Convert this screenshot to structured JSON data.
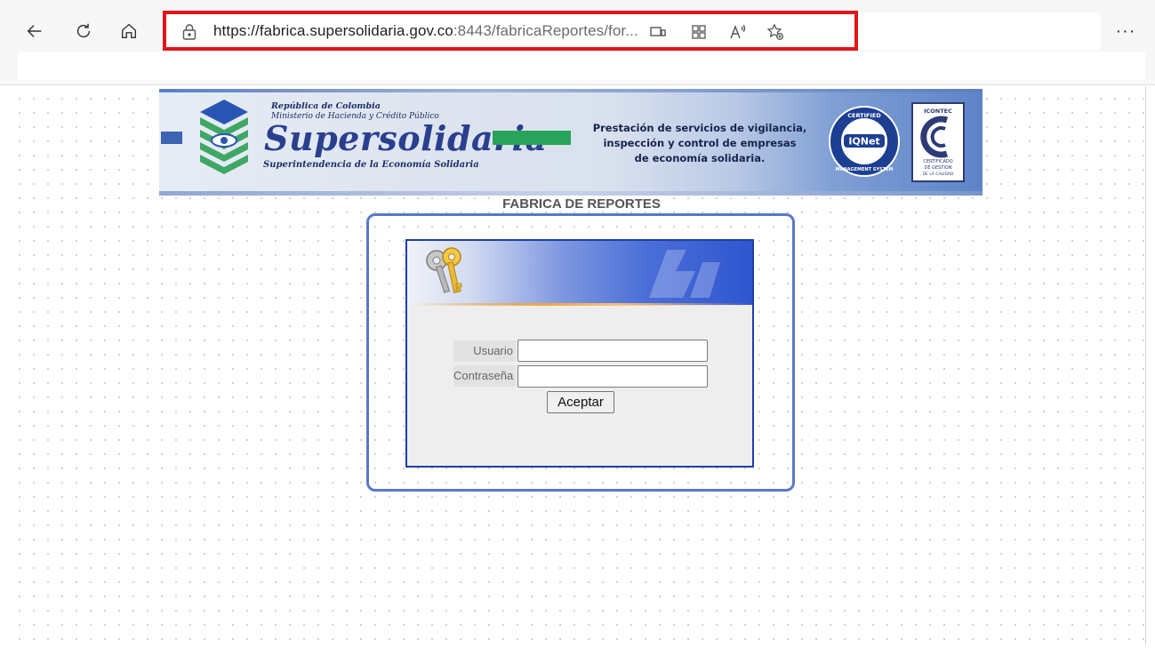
{
  "browser": {
    "address_bar": {
      "url_host": "https://fabrica.supersolidaria.gov.co",
      "url_rest": ":8443/fabricaReportes/for...",
      "icons": [
        "lock-icon",
        "immersive-reader-icon",
        "app-available-icon",
        "read-aloud-icon",
        "add-favorite-icon"
      ]
    },
    "more_label": "···",
    "highlight_color": "#e0161c"
  },
  "banner": {
    "republic": "República de Colombia",
    "ministry": "Ministerio de Hacienda y Crédito Público",
    "brand": "Supersolidaria",
    "subtitle": "Superintendencia de la Economía Solidaria",
    "tagline_1": "Prestación de servicios de vigilancia,",
    "tagline_2": "inspección y control de empresas",
    "tagline_3": "de economía solidaria.",
    "iqnet_top": "CERTIFIED",
    "iqnet_center": "IQNet",
    "iqnet_bottom": "MANAGEMENT SYSTEM",
    "icontec_top": "ICONTEC",
    "icontec_cert_1": "CERTIFICADO",
    "icontec_cert_2": "DE GESTION",
    "icontec_cert_3": "DE LA CALIDAD",
    "brand_color": "#2a3f8e",
    "accent_green": "#27a35b"
  },
  "page_title": "FABRICA DE REPORTES",
  "login": {
    "user_label": "Usuario",
    "user_value": "",
    "password_label": "Contraseña",
    "password_value": "",
    "submit_label": "Aceptar",
    "frame_color": "#5a78c8",
    "box_border_color": "#1f3fa8"
  }
}
